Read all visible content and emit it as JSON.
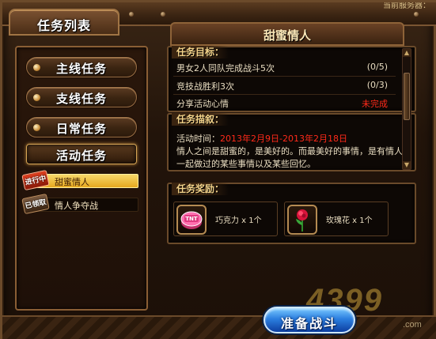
{
  "header": {
    "server_text": "当前服务器：",
    "list_title": "任务列表",
    "detail_title": "甜蜜情人"
  },
  "categories": [
    {
      "label": "主线任务",
      "active": false
    },
    {
      "label": "支线任务",
      "active": false
    },
    {
      "label": "日常任务",
      "active": false
    },
    {
      "label": "活动任务",
      "active": true
    }
  ],
  "quests": [
    {
      "tag": "进行中",
      "name": "甜蜜情人",
      "selected": true
    },
    {
      "tag": "已领取",
      "name": "情人争夺战",
      "selected": false
    }
  ],
  "goals": {
    "heading": "任务目标：",
    "items": [
      {
        "text": "男女2人同队完成战斗5次",
        "progress": "(0/5)"
      },
      {
        "text": "竞技战胜利3次",
        "progress": "(0/3)"
      },
      {
        "text": "分享活动心情",
        "progress": "未完成"
      }
    ]
  },
  "description": {
    "heading": "任务描叙：",
    "time_label": "活动时间：",
    "time_value": "2013年2月9日-2013年2月18日",
    "line1": "情人之间是甜蜜的，是美好的。而最美好的事情，是有情人",
    "line2": "一起做过的某些事情以及某些回忆。"
  },
  "rewards": {
    "heading": "任务奖励：",
    "items": [
      {
        "name": "巧克力 x 1个",
        "icon": "chocolate-icon",
        "icon_text": "TNT"
      },
      {
        "name": "玫瑰花 x 1个",
        "icon": "rose-icon"
      }
    ]
  },
  "start_button": {
    "label": "准备战斗"
  },
  "watermark": {
    "main": "4399",
    "sub": ".com"
  },
  "colors": {
    "accent_gold": "#f4d38a",
    "incomplete_red": "#ff2a1a",
    "button_blue": "#2c7fe0"
  }
}
